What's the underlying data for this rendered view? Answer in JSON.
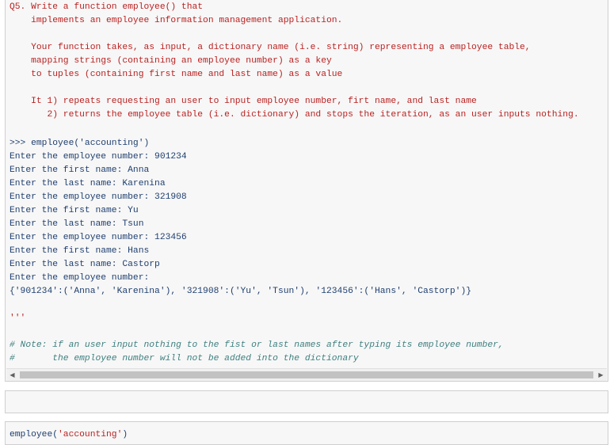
{
  "docstring": "Q5. Write a function employee() that\n    implements an employee information management application.\n\n    Your function takes, as input, a dictionary name (i.e. string) representing a employee table,\n    mapping strings (containing an employee number) as a key\n    to tuples (containing first name and last name) as a value\n\n    It 1) repeats requesting an user to input employee number, firt name, and last name\n       2) returns the employee table (i.e. dictionary) and stops the iteration, as an user inputs nothing.",
  "output_lines": [
    ">>> employee('accounting')",
    "Enter the employee number: 901234",
    "Enter the first name: Anna",
    "Enter the last name: Karenina",
    "Enter the employee number: 321908",
    "Enter the first name: Yu",
    "Enter the last name: Tsun",
    "Enter the employee number: 123456",
    "Enter the first name: Hans",
    "Enter the last name: Castorp",
    "Enter the employee number:"
  ],
  "result_line": "{'901234':('Anna', 'Karenina'), '321908':('Yu', 'Tsun'), '123456':('Hans', 'Castorp')}",
  "docstring_close": "'''",
  "comments": "# Note: if an user input nothing to the fist or last names after typing its employee number,\n#       the employee number will not be added into the dictionary",
  "scroll_left_arrow": "◀",
  "scroll_right_arrow": "▶",
  "input_cell": {
    "code_prefix": "employee(",
    "code_arg": "'accounting'",
    "code_suffix": ")"
  }
}
